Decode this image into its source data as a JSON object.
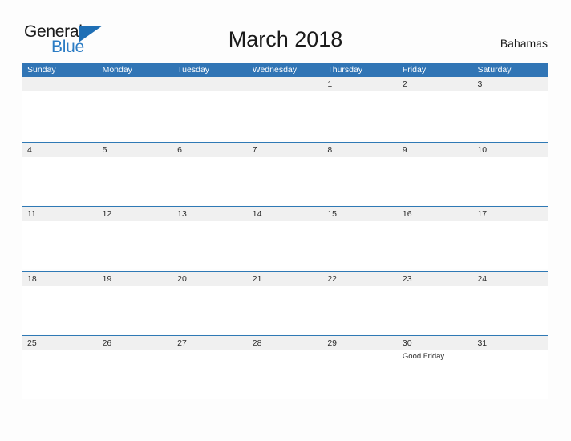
{
  "brand": {
    "word_one": "General",
    "word_two": "Blue",
    "flag_icon": "triangle-flag-icon",
    "flag_color": "#1f6fb5"
  },
  "header": {
    "title": "March 2018",
    "country": "Bahamas"
  },
  "colors": {
    "header_blue": "#3175b5",
    "row_border": "#2f79b5",
    "band_gray": "#f0f0f0",
    "brand_blue": "#2b7cc4",
    "page_background": "#fdfdfd"
  },
  "calendar": {
    "weekdays": [
      "Sunday",
      "Monday",
      "Tuesday",
      "Wednesday",
      "Thursday",
      "Friday",
      "Saturday"
    ],
    "weeks": [
      {
        "days": [
          {
            "date": "",
            "events": []
          },
          {
            "date": "",
            "events": []
          },
          {
            "date": "",
            "events": []
          },
          {
            "date": "",
            "events": []
          },
          {
            "date": "1",
            "events": []
          },
          {
            "date": "2",
            "events": []
          },
          {
            "date": "3",
            "events": []
          }
        ]
      },
      {
        "days": [
          {
            "date": "4",
            "events": []
          },
          {
            "date": "5",
            "events": []
          },
          {
            "date": "6",
            "events": []
          },
          {
            "date": "7",
            "events": []
          },
          {
            "date": "8",
            "events": []
          },
          {
            "date": "9",
            "events": []
          },
          {
            "date": "10",
            "events": []
          }
        ]
      },
      {
        "days": [
          {
            "date": "11",
            "events": []
          },
          {
            "date": "12",
            "events": []
          },
          {
            "date": "13",
            "events": []
          },
          {
            "date": "14",
            "events": []
          },
          {
            "date": "15",
            "events": []
          },
          {
            "date": "16",
            "events": []
          },
          {
            "date": "17",
            "events": []
          }
        ]
      },
      {
        "days": [
          {
            "date": "18",
            "events": []
          },
          {
            "date": "19",
            "events": []
          },
          {
            "date": "20",
            "events": []
          },
          {
            "date": "21",
            "events": []
          },
          {
            "date": "22",
            "events": []
          },
          {
            "date": "23",
            "events": []
          },
          {
            "date": "24",
            "events": []
          }
        ]
      },
      {
        "days": [
          {
            "date": "25",
            "events": []
          },
          {
            "date": "26",
            "events": []
          },
          {
            "date": "27",
            "events": []
          },
          {
            "date": "28",
            "events": []
          },
          {
            "date": "29",
            "events": []
          },
          {
            "date": "30",
            "events": [
              "Good Friday"
            ]
          },
          {
            "date": "31",
            "events": []
          }
        ]
      }
    ]
  }
}
